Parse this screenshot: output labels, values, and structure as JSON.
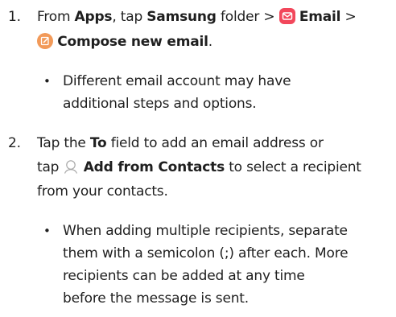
{
  "steps": [
    {
      "number": "1.",
      "line1": {
        "t1": "From ",
        "apps": "Apps",
        "t2": ", tap ",
        "samsung": "Samsung",
        "t3": " folder > ",
        "email": "Email",
        "t4": " >"
      },
      "line2": {
        "compose": "Compose new email",
        "t1": "."
      },
      "note": {
        "bullet": "•",
        "line1": "Different email account may have",
        "line2": "additional steps and options."
      }
    },
    {
      "number": "2.",
      "line1": {
        "t1": "Tap the ",
        "to": "To",
        "t2": " field to add an email address or"
      },
      "line2": {
        "t1": "tap ",
        "add_contacts": "Add from Contacts",
        "t2": " to select a recipient"
      },
      "line3": "from your contacts.",
      "note": {
        "bullet": "•",
        "line1": "When adding multiple recipients, separate",
        "line2": "them with a semicolon (;) after each. More",
        "line3": "recipients can be added at any time",
        "line4": "before the message is sent."
      }
    }
  ],
  "icons": {
    "email": "email-app-icon",
    "compose": "compose-icon",
    "contacts": "add-contact-icon"
  },
  "colors": {
    "email_icon": "#f2475b",
    "compose_icon": "#f29a59",
    "text": "#1f1f1f"
  }
}
